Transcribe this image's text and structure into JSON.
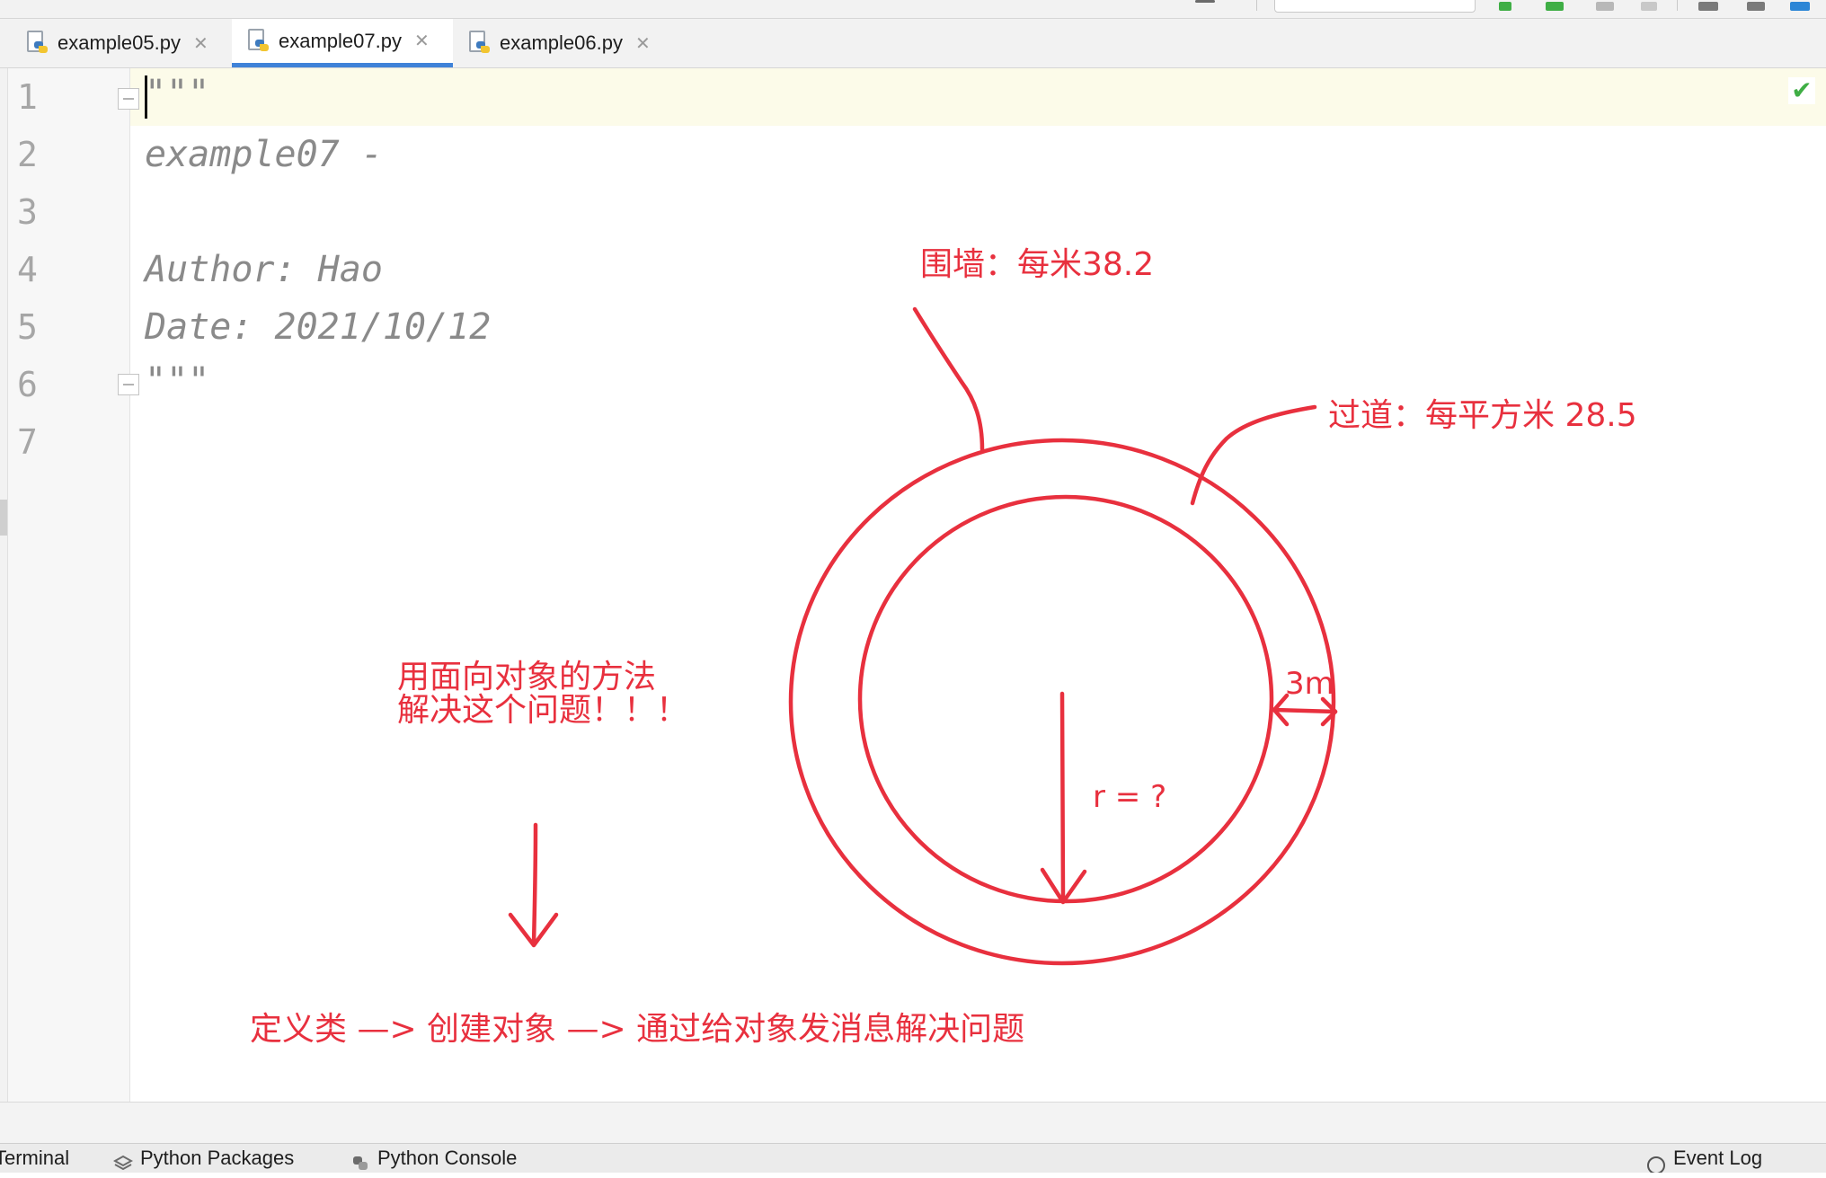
{
  "tabs": [
    {
      "label": "example05.py",
      "active": false
    },
    {
      "label": "example07.py",
      "active": true
    },
    {
      "label": "example06.py",
      "active": false
    }
  ],
  "editor": {
    "line_numbers": [
      "1",
      "2",
      "3",
      "4",
      "5",
      "6",
      "7"
    ],
    "lines": [
      "\"\"\"",
      "example07 -",
      "",
      "Author: Hao",
      "Date: 2021/10/12",
      "\"\"\"",
      ""
    ],
    "current_line": 1
  },
  "annotations": {
    "wall": "围墙：每米38.2",
    "aisle": "过道：每平方米 28.5",
    "width": "3m",
    "radius": "r = ?",
    "hint_line1": "用面向对象的方法",
    "hint_line2": "解决这个问题！！！",
    "flow": "定义类 —> 创建对象 —> 通过给对象发消息解决问题"
  },
  "statusbar": {
    "terminal": "Terminal",
    "python_packages": "Python Packages",
    "python_console": "Python Console",
    "event_log": "Event Log"
  },
  "colors": {
    "annotation": "#e8303e",
    "tab_underline": "#3f82d8",
    "current_line": "#fcfbe9",
    "check": "#3fae45"
  }
}
